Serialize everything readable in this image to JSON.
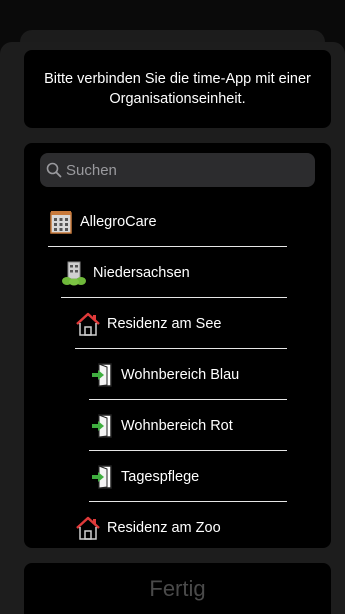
{
  "message": "Bitte verbinden Sie die  time-App mit einer Organisationseinheit.",
  "search": {
    "placeholder": "Suchen"
  },
  "items": [
    {
      "label": "AllegroCare",
      "icon": "building-icon",
      "level": 0
    },
    {
      "label": "Niedersachsen",
      "icon": "region-building-icon",
      "level": 1
    },
    {
      "label": "Residenz am See",
      "icon": "house-icon",
      "level": 2
    },
    {
      "label": "Wohnbereich Blau",
      "icon": "door-enter-icon",
      "level": 3
    },
    {
      "label": "Wohnbereich Rot",
      "icon": "door-enter-icon",
      "level": 3
    },
    {
      "label": "Tagespflege",
      "icon": "door-enter-icon",
      "level": 3
    },
    {
      "label": "Residenz am Zoo",
      "icon": "house-icon",
      "level": 2
    }
  ],
  "done_label": "Fertig",
  "colors": {
    "background": "#0a0a0a",
    "card": "#000000",
    "search_field": "#2c2c2e",
    "disabled_text": "#4a4a4a"
  }
}
